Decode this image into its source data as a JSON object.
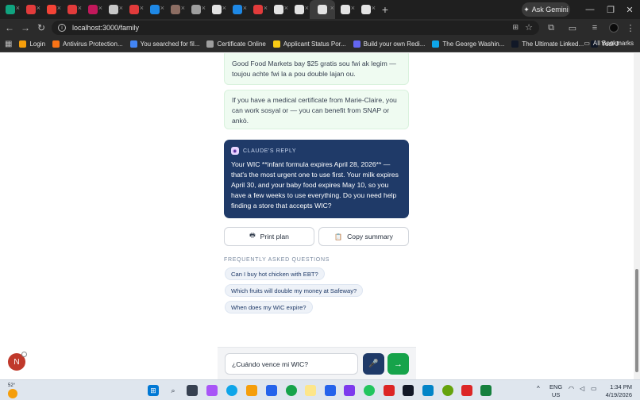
{
  "browser": {
    "tabs": [
      {
        "icon": "chatgpt-icon",
        "color": "#10a37f"
      },
      {
        "icon": "site-icon",
        "color": "#e23b3b"
      },
      {
        "icon": "site-icon",
        "color": "#f44336"
      },
      {
        "icon": "pdf-icon",
        "color": "#e23b3b"
      },
      {
        "icon": "site-icon",
        "color": "#c2185b"
      },
      {
        "icon": "gmail-icon",
        "color": "#c7c7c7"
      },
      {
        "icon": "site-icon",
        "color": "#e23b3b"
      },
      {
        "icon": "drive-icon",
        "color": "#1e88e5"
      },
      {
        "icon": "site-icon",
        "color": "#8d6e63"
      },
      {
        "icon": "site-icon",
        "color": "#9e9e9e"
      },
      {
        "icon": "github-icon",
        "color": "#e3e3e3"
      },
      {
        "icon": "drive-icon",
        "color": "#1e88e5"
      },
      {
        "icon": "site-icon",
        "color": "#e23b3b"
      },
      {
        "icon": "site-icon",
        "color": "#e3e3e3"
      },
      {
        "icon": "site-icon",
        "color": "#e3e3e3"
      },
      {
        "icon": "site-icon",
        "color": "#e3e3e3"
      },
      {
        "icon": "site-icon",
        "color": "#e3e3e3"
      },
      {
        "icon": "site-icon",
        "color": "#e3e3e3"
      }
    ],
    "ask_gemini": "Ask Gemini",
    "url": "localhost:3000/family",
    "bookmarks": [
      {
        "label": "Login",
        "color": "#f59e0b"
      },
      {
        "label": "Antivirus Protection...",
        "color": "#f97316"
      },
      {
        "label": "You searched for fil...",
        "color": "#4285f4"
      },
      {
        "label": "Certificate Online",
        "color": "#9e9e9e"
      },
      {
        "label": "Applicant Status Por...",
        "color": "#facc15"
      },
      {
        "label": "Build your own Redi...",
        "color": "#6366f1"
      },
      {
        "label": "The George Washin...",
        "color": "#0ea5e9"
      },
      {
        "label": "The Ultimate Linked...",
        "color": "#111827"
      },
      {
        "label": "Yudi J",
        "color": "#111827"
      }
    ],
    "all_bookmarks": "All Bookmarks"
  },
  "chat": {
    "messages": [
      {
        "text": "Good Food Markets bay $25 gratis sou fwi ak legim — toujou achte fwi la a pou double lajan ou."
      },
      {
        "text": "If you have a medical certificate from Marie-Claire, you can work sosyal or — you can benefit from SNAP or ankò."
      }
    ],
    "reply": {
      "label": "CLAUDE'S REPLY",
      "text": "Your WIC **infant formula expires April 28, 2026** — that's the most urgent one to use first. Your milk expires April 30, and your baby food expires May 10, so you have a few weeks to use everything. Do you need help finding a store that accepts WIC?"
    },
    "actions": {
      "print": "Print plan",
      "copy": "Copy summary"
    },
    "faq": {
      "title": "FREQUENTLY ASKED QUESTIONS",
      "items": [
        "Can I buy hot chicken with EBT?",
        "Which fruits will double my money at Safeway?",
        "When does my WIC expire?"
      ]
    },
    "input_value": "¿Cuándo vence mi WIC?",
    "avatar_initial": "N"
  },
  "taskbar": {
    "temp": "52°",
    "lang_1": "ENG",
    "lang_2": "US",
    "time": "1:34 PM",
    "date": "4/19/2026"
  }
}
